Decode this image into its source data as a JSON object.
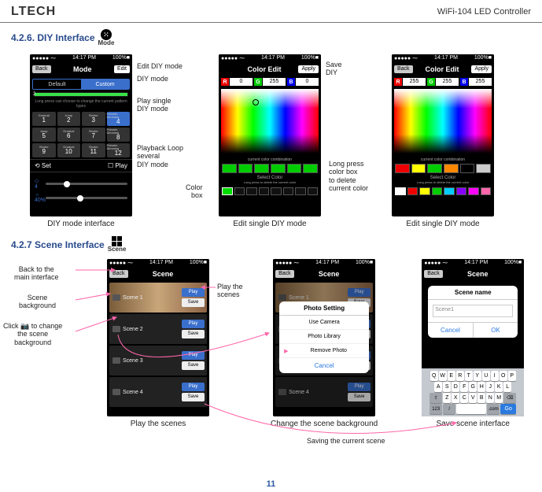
{
  "header": {
    "logo": "LTECH",
    "doc": "WiFi-104 LED Controller"
  },
  "s1": {
    "title": "4.2.6. DIY Interface",
    "modeIconLabel": "Mode",
    "callouts": {
      "edit": "Edit DIY mode",
      "diymode": "DIY mode",
      "playsingle": "Play single\nDIY mode",
      "loop": "Playback Loop\nseveral\nDIY mode",
      "colorbox": "Color\nbox",
      "savediy": "Save\nDIY",
      "longpress": "Long press\ncolor box\nto delete\ncurrent color"
    },
    "captions": {
      "p1": "DIY mode interface",
      "p2": "Edit single DIY mode",
      "p3": "Edit single DIY mode"
    },
    "statusbar": {
      "left": "●●●●● ⁓",
      "time": "14:17 PM",
      "right": "100%■"
    },
    "nav": {
      "back": "Back",
      "edit": "Edit",
      "apply": "Apply",
      "mode": "Mode",
      "coloredit": "Color Edit"
    },
    "seg": {
      "a": "Default",
      "b": "Custom"
    },
    "progressNum": "2",
    "captionStrip": "Long press can choose to change the current pattern types",
    "modes": [
      {
        "t": "Gradual",
        "n": "1"
      },
      {
        "t": "Jump",
        "n": "2"
      },
      {
        "t": "Strobe",
        "n": "3"
      },
      {
        "t": "Pulsate-Dimming",
        "n": "4"
      },
      {
        "t": "Jump",
        "n": "5"
      },
      {
        "t": "Gradual",
        "n": "6"
      },
      {
        "t": "Strobe",
        "n": "7"
      },
      {
        "t": "Pulsate-Dimming",
        "n": "8"
      },
      {
        "t": "Strobe",
        "n": "9"
      },
      {
        "t": "Gradual",
        "n": "10"
      },
      {
        "t": "Strobe",
        "n": "11"
      },
      {
        "t": "Pulsate-Dimming",
        "n": "12"
      }
    ],
    "setplay": {
      "set": "⟲ Set",
      "play": "☐ Play"
    },
    "sliders": {
      "speed": "◇ 4",
      "bright": "☼ 40%"
    },
    "rgbA": {
      "r": "0",
      "g": "255",
      "b": "0"
    },
    "rgbB": {
      "r": "255",
      "g": "255",
      "b": "255"
    },
    "combo": "current color combination",
    "selcolor": "Select Color",
    "selcolor_sub": "Long press to delete the current color",
    "palette": [
      "#e00",
      "#ff0",
      "#0c0",
      "#f80",
      "#000",
      "#ccc"
    ],
    "palette2": [
      "#fff",
      "#e00",
      "#ff0",
      "#0c0",
      "#0cf",
      "#80f",
      "#f0f",
      "#f6a"
    ]
  },
  "s2": {
    "title": "4.2.7 Scene Interface",
    "sceneIconLabel": "Scene",
    "callouts": {
      "back": "Back to the\nmain interface",
      "scenebg": "Scene\nbackground",
      "clickcam": "Click 📷 to change\nthe scene\nbackground",
      "playscenes": "Play the\nscenes",
      "changebg": "Change the scene background",
      "saving": "Saving the current scene",
      "saveif": "Save scene interface"
    },
    "captions": {
      "p1": "Play the scenes"
    },
    "nav": {
      "title": "Scene",
      "back": "Back"
    },
    "scenes": [
      "Scene 1",
      "Scene 2",
      "Scene 3",
      "Scene 4"
    ],
    "btns": {
      "play": "Play",
      "save": "Save"
    },
    "modal": {
      "photo_title": "Photo Setting",
      "useCam": "Use Camera",
      "lib": "Photo Library",
      "remove": "Remove Photo",
      "cancel": "Cancel",
      "scene_name_title": "Scene name",
      "placeholder": "Scene1",
      "ok": "OK"
    },
    "kbd": {
      "r1": [
        "Q",
        "W",
        "E",
        "R",
        "T",
        "Y",
        "U",
        "I",
        "O",
        "P"
      ],
      "r2": [
        "A",
        "S",
        "D",
        "F",
        "G",
        "H",
        "J",
        "K",
        "L"
      ],
      "r3": [
        "⇧",
        "Z",
        "X",
        "C",
        "V",
        "B",
        "N",
        "M",
        "⌫"
      ],
      "r4": [
        "123",
        "/",
        "|",
        ".com",
        "Go"
      ]
    }
  },
  "pageNum": "11"
}
